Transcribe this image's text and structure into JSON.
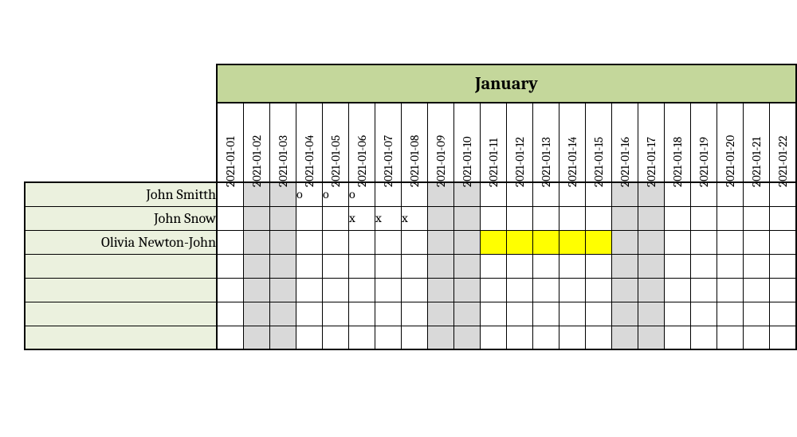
{
  "month_label": "January",
  "dates": [
    "2021-01-01",
    "2021-01-02",
    "2021-01-03",
    "2021-01-04",
    "2021-01-05",
    "2021-01-06",
    "2021-01-07",
    "2021-01-08",
    "2021-01-09",
    "2021-01-10",
    "2021-01-11",
    "2021-01-12",
    "2021-01-13",
    "2021-01-14",
    "2021-01-15",
    "2021-01-16",
    "2021-01-17",
    "2021-01-18",
    "2021-01-19",
    "2021-01-20",
    "2021-01-21",
    "2021-01-22"
  ],
  "weekend_cols": [
    1,
    2,
    8,
    9,
    15,
    16
  ],
  "rows": [
    {
      "name": "John Smitth",
      "cells": [
        {
          "v": ""
        },
        {
          "v": ""
        },
        {
          "v": ""
        },
        {
          "v": "o"
        },
        {
          "v": "o"
        },
        {
          "v": "o"
        },
        {
          "v": ""
        },
        {
          "v": ""
        },
        {
          "v": ""
        },
        {
          "v": ""
        },
        {
          "v": ""
        },
        {
          "v": ""
        },
        {
          "v": ""
        },
        {
          "v": ""
        },
        {
          "v": ""
        },
        {
          "v": ""
        },
        {
          "v": ""
        },
        {
          "v": ""
        },
        {
          "v": ""
        },
        {
          "v": ""
        },
        {
          "v": ""
        },
        {
          "v": ""
        }
      ]
    },
    {
      "name": "John Snow",
      "cells": [
        {
          "v": ""
        },
        {
          "v": ""
        },
        {
          "v": ""
        },
        {
          "v": ""
        },
        {
          "v": ""
        },
        {
          "v": "x"
        },
        {
          "v": "x"
        },
        {
          "v": "x"
        },
        {
          "v": ""
        },
        {
          "v": ""
        },
        {
          "v": ""
        },
        {
          "v": ""
        },
        {
          "v": ""
        },
        {
          "v": ""
        },
        {
          "v": ""
        },
        {
          "v": ""
        },
        {
          "v": ""
        },
        {
          "v": ""
        },
        {
          "v": ""
        },
        {
          "v": ""
        },
        {
          "v": ""
        },
        {
          "v": ""
        }
      ]
    },
    {
      "name": "Olivia Newton-John",
      "cells": [
        {
          "v": ""
        },
        {
          "v": ""
        },
        {
          "v": ""
        },
        {
          "v": ""
        },
        {
          "v": ""
        },
        {
          "v": ""
        },
        {
          "v": ""
        },
        {
          "v": ""
        },
        {
          "v": ""
        },
        {
          "v": ""
        },
        {
          "v": "",
          "hl": true
        },
        {
          "v": "",
          "hl": true
        },
        {
          "v": "",
          "hl": true
        },
        {
          "v": "",
          "hl": true
        },
        {
          "v": "",
          "hl": true
        },
        {
          "v": ""
        },
        {
          "v": ""
        },
        {
          "v": ""
        },
        {
          "v": ""
        },
        {
          "v": ""
        },
        {
          "v": ""
        },
        {
          "v": ""
        }
      ]
    },
    {
      "name": "",
      "cells": [
        {
          "v": ""
        },
        {
          "v": ""
        },
        {
          "v": ""
        },
        {
          "v": ""
        },
        {
          "v": ""
        },
        {
          "v": ""
        },
        {
          "v": ""
        },
        {
          "v": ""
        },
        {
          "v": ""
        },
        {
          "v": ""
        },
        {
          "v": ""
        },
        {
          "v": ""
        },
        {
          "v": ""
        },
        {
          "v": ""
        },
        {
          "v": ""
        },
        {
          "v": ""
        },
        {
          "v": ""
        },
        {
          "v": ""
        },
        {
          "v": ""
        },
        {
          "v": ""
        },
        {
          "v": ""
        },
        {
          "v": ""
        }
      ]
    },
    {
      "name": "",
      "cells": [
        {
          "v": ""
        },
        {
          "v": ""
        },
        {
          "v": ""
        },
        {
          "v": ""
        },
        {
          "v": ""
        },
        {
          "v": ""
        },
        {
          "v": ""
        },
        {
          "v": ""
        },
        {
          "v": ""
        },
        {
          "v": ""
        },
        {
          "v": ""
        },
        {
          "v": ""
        },
        {
          "v": ""
        },
        {
          "v": ""
        },
        {
          "v": ""
        },
        {
          "v": ""
        },
        {
          "v": ""
        },
        {
          "v": ""
        },
        {
          "v": ""
        },
        {
          "v": ""
        },
        {
          "v": ""
        },
        {
          "v": ""
        }
      ]
    },
    {
      "name": "",
      "cells": [
        {
          "v": ""
        },
        {
          "v": ""
        },
        {
          "v": ""
        },
        {
          "v": ""
        },
        {
          "v": ""
        },
        {
          "v": ""
        },
        {
          "v": ""
        },
        {
          "v": ""
        },
        {
          "v": ""
        },
        {
          "v": ""
        },
        {
          "v": ""
        },
        {
          "v": ""
        },
        {
          "v": ""
        },
        {
          "v": ""
        },
        {
          "v": ""
        },
        {
          "v": ""
        },
        {
          "v": ""
        },
        {
          "v": ""
        },
        {
          "v": ""
        },
        {
          "v": ""
        },
        {
          "v": ""
        },
        {
          "v": ""
        }
      ]
    },
    {
      "name": "",
      "cells": [
        {
          "v": ""
        },
        {
          "v": ""
        },
        {
          "v": ""
        },
        {
          "v": ""
        },
        {
          "v": ""
        },
        {
          "v": ""
        },
        {
          "v": ""
        },
        {
          "v": ""
        },
        {
          "v": ""
        },
        {
          "v": ""
        },
        {
          "v": ""
        },
        {
          "v": ""
        },
        {
          "v": ""
        },
        {
          "v": ""
        },
        {
          "v": ""
        },
        {
          "v": ""
        },
        {
          "v": ""
        },
        {
          "v": ""
        },
        {
          "v": ""
        },
        {
          "v": ""
        },
        {
          "v": ""
        },
        {
          "v": ""
        }
      ]
    }
  ]
}
